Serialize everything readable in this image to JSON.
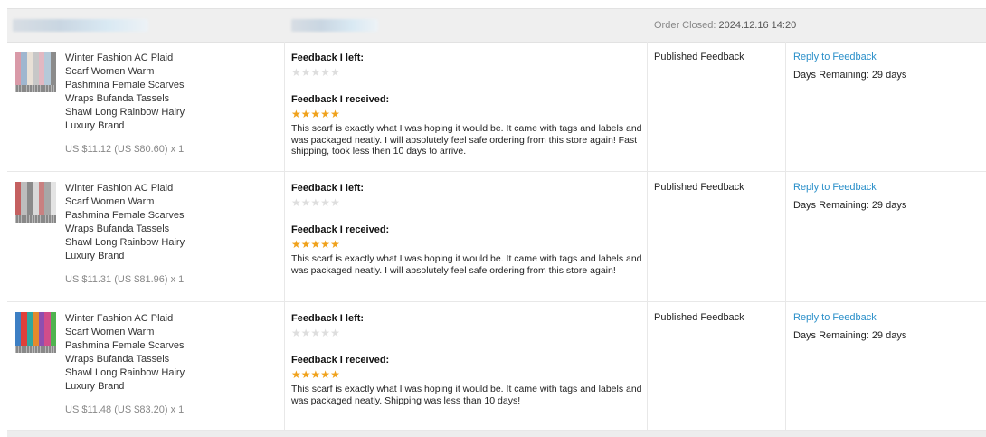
{
  "order_header": {
    "closed_label": "Order Closed:",
    "closed_value": "2024.12.16 14:20"
  },
  "labels": {
    "feedback_left": "Feedback I left:",
    "feedback_received": "Feedback I received:"
  },
  "items": [
    {
      "name": "Winter Fashion AC Plaid Scarf Women Warm Pashmina Female Scarves Wraps Bufanda Tassels Shawl Long Rainbow Hairy Luxury Brand",
      "price": "US $11.12 (US $80.60) x 1",
      "left_stars": 0,
      "received_stars": 5,
      "received_text": "This scarf is exactly what I was hoping it would be. It came with tags and labels and was packaged neatly. I will absolutely feel safe ordering from this store again! Fast shipping, took less then 10 days to arrive.",
      "status": "Published Feedback",
      "reply_label": "Reply to Feedback",
      "days_remaining": "Days Remaining: 29 days",
      "thumb_colors": [
        "#d99aa8",
        "#9fb6cf",
        "#e8e0d6",
        "#c7c7c7",
        "#e2b8c2",
        "#b5c9d9",
        "#8b8b8b"
      ]
    },
    {
      "name": "Winter Fashion AC Plaid Scarf Women Warm Pashmina Female Scarves Wraps Bufanda Tassels Shawl Long Rainbow Hairy Luxury Brand",
      "price": "US $11.31 (US $81.96) x 1",
      "left_stars": 0,
      "received_stars": 5,
      "received_text": "This scarf is exactly what I was hoping it would be. It came with tags and labels and was packaged neatly. I will absolutely feel safe ordering from this store again!",
      "status": "Published Feedback",
      "reply_label": "Reply to Feedback",
      "days_remaining": "Days Remaining: 29 days",
      "thumb_colors": [
        "#c46060",
        "#bdbdbd",
        "#8a8a8a",
        "#d9d9d9",
        "#c98080",
        "#a7a7a7",
        "#e4e4e4"
      ]
    },
    {
      "name": "Winter Fashion AC Plaid Scarf Women Warm Pashmina Female Scarves Wraps Bufanda Tassels Shawl Long Rainbow Hairy Luxury Brand",
      "price": "US $11.48 (US $83.20) x 1",
      "left_stars": 0,
      "received_stars": 5,
      "received_text": "This scarf is exactly what I was hoping it would be. It came with tags and labels and was packaged neatly. Shipping was less than 10 days!",
      "status": "Published Feedback",
      "reply_label": "Reply to Feedback",
      "days_remaining": "Days Remaining: 29 days",
      "thumb_colors": [
        "#3d7fc4",
        "#e0403a",
        "#2fa7a0",
        "#e48a2c",
        "#8e4fb0",
        "#d14d8a",
        "#4fb34f"
      ]
    }
  ],
  "colors": {
    "link": "#2a8fc9",
    "star_full": "#f0a21c",
    "star_empty": "#dedede",
    "header_bg": "#efefef"
  }
}
